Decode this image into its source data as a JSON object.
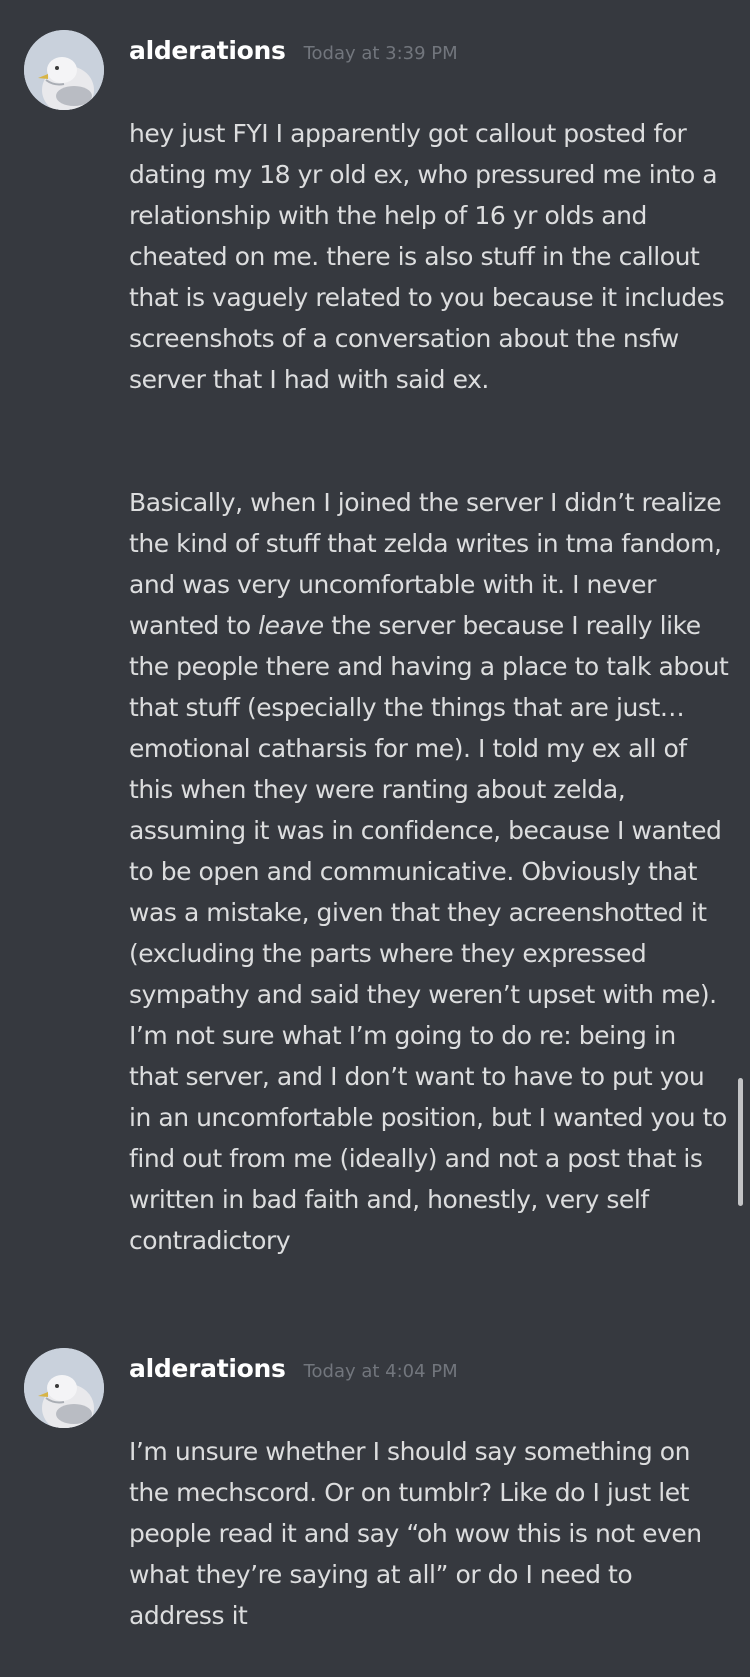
{
  "messages": [
    {
      "username": "alderations",
      "timestamp": "Today at 3:39 PM",
      "avatar_icon": "seagull-avatar",
      "paragraph1": "hey just FYI I apparently got callout posted for dating my 18 yr old ex, who pressured me into a relationship with the help of 16 yr olds and cheated on me. there is also stuff in the callout that is vaguely related to you because it includes screenshots of a conversation about the nsfw server that I had with said ex.",
      "paragraph2_before_italic": "Basically, when I joined the server I didn’t realize the kind of stuff that zelda writes in tma fandom, and was  very uncomfortable with it. I never wanted to ",
      "paragraph2_italic": "leave",
      "paragraph2_after_italic": " the server because I really like the people there and having a place to talk about that stuff (especially the things that are just… emotional catharsis for me). I told my ex all of this when they were ranting about zelda, assuming it was in confidence, because I wanted to be open and communicative. Obviously that was a mistake, given that they acreenshotted it (excluding the parts where they expressed sympathy and said they weren’t upset with me). I’m not sure what I’m going to do re: being in that server, and I don’t want to have to put you in an uncomfortable position, but I wanted you to find out from me (ideally) and not a post that is written in bad faith and, honestly, very self contradictory"
    },
    {
      "username": "alderations",
      "timestamp": "Today at 4:04 PM",
      "avatar_icon": "seagull-avatar",
      "paragraph1": "I’m unsure whether I should say something on the mechscord. Or on tumblr? Like do I just let people read it and say “oh wow this is not even what they’re saying at all” or do I need to address it"
    }
  ],
  "colors": {
    "background": "#36393f",
    "username": "#ffffff",
    "timestamp": "#72767d",
    "message_text": "#dcddde"
  }
}
